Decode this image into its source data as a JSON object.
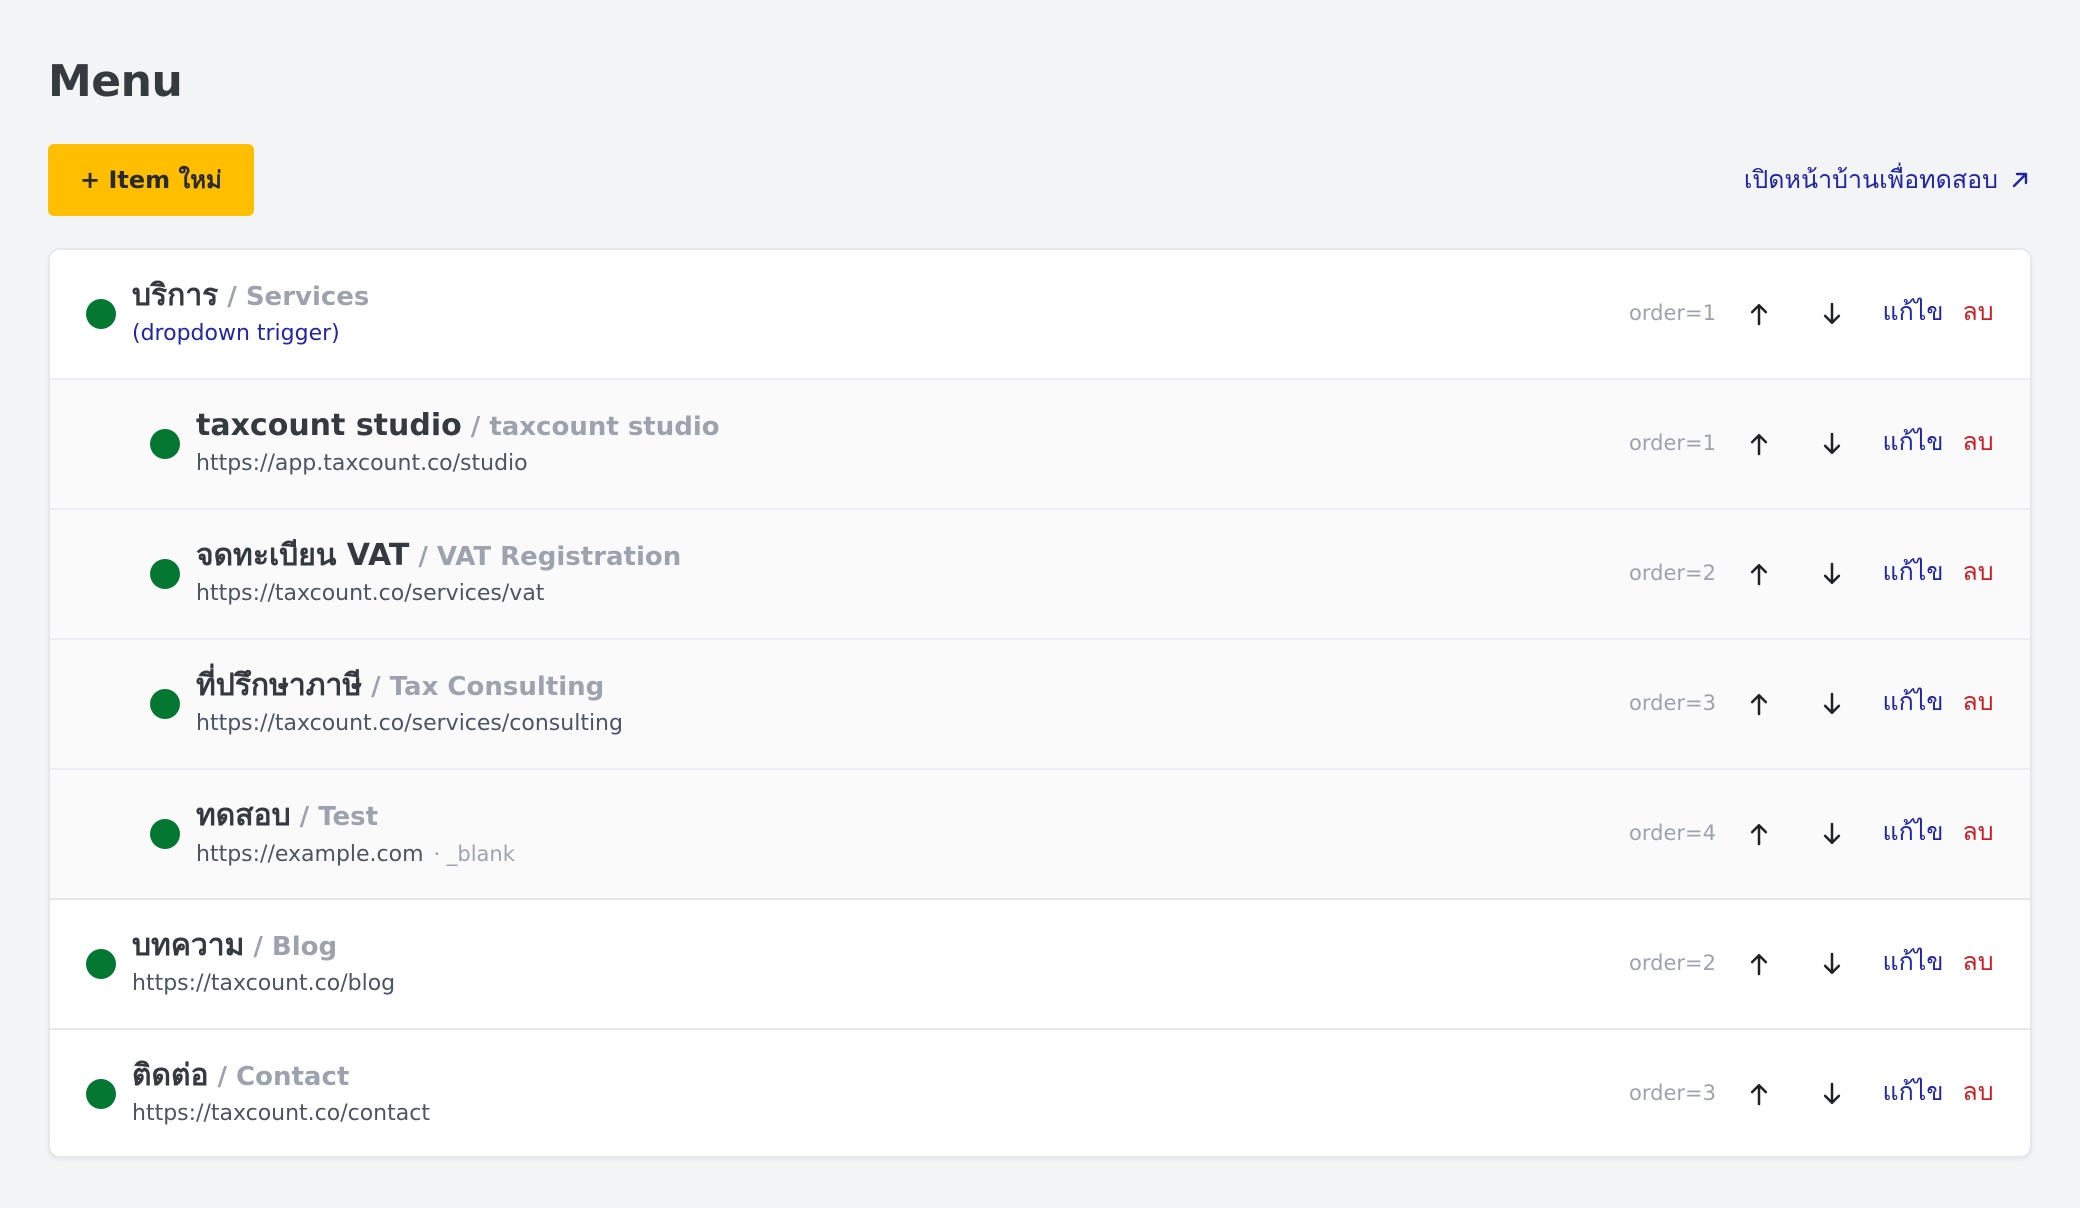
{
  "page": {
    "title": "Menu"
  },
  "toolbar": {
    "new_item_label": "+ Item ใหม่",
    "homepage_link_label": "เปิดหน้าบ้านเพื่อทดสอบ",
    "homepage_link_icon": "external-link-icon"
  },
  "menu": {
    "items": [
      {
        "primary": "บริการ",
        "secondary": "/ Services",
        "subtext": "(dropdown trigger)",
        "meta": "",
        "order": "order=1",
        "status": "active",
        "type": "dropdown-trigger",
        "level": 1,
        "actions": {
          "up_icon": "arrow-up-icon",
          "down_icon": "arrow-down-icon",
          "edit": "แก้ไข",
          "delete": "ลบ"
        }
      },
      {
        "primary": "taxcount studio",
        "secondary": "/ taxcount studio",
        "subtext": "https://app.taxcount.co/studio",
        "meta": "",
        "order": "order=1",
        "status": "active",
        "type": "child",
        "level": 2,
        "actions": {
          "up_icon": "arrow-up-icon",
          "down_icon": "arrow-down-icon",
          "edit": "แก้ไข",
          "delete": "ลบ"
        }
      },
      {
        "primary": "จดทะเบียน VAT",
        "secondary": "/ VAT Registration",
        "subtext": "https://taxcount.co/services/vat",
        "meta": "",
        "order": "order=2",
        "status": "active",
        "type": "child",
        "level": 2,
        "actions": {
          "up_icon": "arrow-up-icon",
          "down_icon": "arrow-down-icon",
          "edit": "แก้ไข",
          "delete": "ลบ"
        }
      },
      {
        "primary": "ที่ปรึกษาภาษี",
        "secondary": "/ Tax Consulting",
        "subtext": "https://taxcount.co/services/consulting",
        "meta": "",
        "order": "order=3",
        "status": "active",
        "type": "child",
        "level": 2,
        "actions": {
          "up_icon": "arrow-up-icon",
          "down_icon": "arrow-down-icon",
          "edit": "แก้ไข",
          "delete": "ลบ"
        }
      },
      {
        "primary": "ทดสอบ",
        "secondary": "/ Test",
        "subtext": "https://example.com",
        "meta": "· _blank",
        "order": "order=4",
        "status": "active",
        "type": "child",
        "level": 2,
        "actions": {
          "up_icon": "arrow-up-icon",
          "down_icon": "arrow-down-icon",
          "edit": "แก้ไข",
          "delete": "ลบ"
        }
      },
      {
        "primary": "บทความ",
        "secondary": "/ Blog",
        "subtext": "https://taxcount.co/blog",
        "meta": "",
        "order": "order=2",
        "status": "active",
        "type": "link",
        "level": 1,
        "actions": {
          "up_icon": "arrow-up-icon",
          "down_icon": "arrow-down-icon",
          "edit": "แก้ไข",
          "delete": "ลบ"
        }
      },
      {
        "primary": "ติดต่อ",
        "secondary": "/ Contact",
        "subtext": "https://taxcount.co/contact",
        "meta": "",
        "order": "order=3",
        "status": "active",
        "type": "link",
        "level": 1,
        "actions": {
          "up_icon": "arrow-up-icon",
          "down_icon": "arrow-down-icon",
          "edit": "แก้ไข",
          "delete": "ลบ"
        }
      }
    ]
  },
  "colors": {
    "background": "#f3f4f6",
    "surface": "#ffffff",
    "child_row": "#fafafa",
    "primary_text": "#343a40",
    "muted_text": "#9ca3af",
    "accent_yellow": "#ffbf00",
    "link_blue": "#2126a8",
    "delete_red": "#c91f25",
    "active_green": "#047732"
  }
}
